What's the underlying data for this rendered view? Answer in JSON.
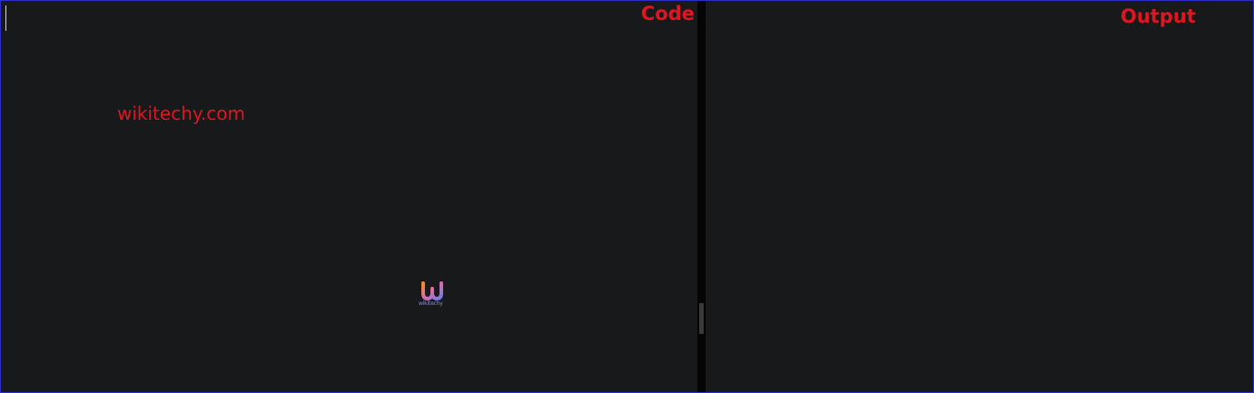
{
  "code_pane": {
    "label": "Code",
    "watermark": "wikitechy.com",
    "logo_text": "wikitechy"
  },
  "output_pane": {
    "label": "Output"
  },
  "colors": {
    "label_red": "#e0151f",
    "background": "#18191b",
    "splitter": "#050505",
    "frame_border": "#2c2cc8"
  },
  "icons": {
    "logo": "wikitechy-logo-icon",
    "splitter": "splitter-grip-icon"
  }
}
